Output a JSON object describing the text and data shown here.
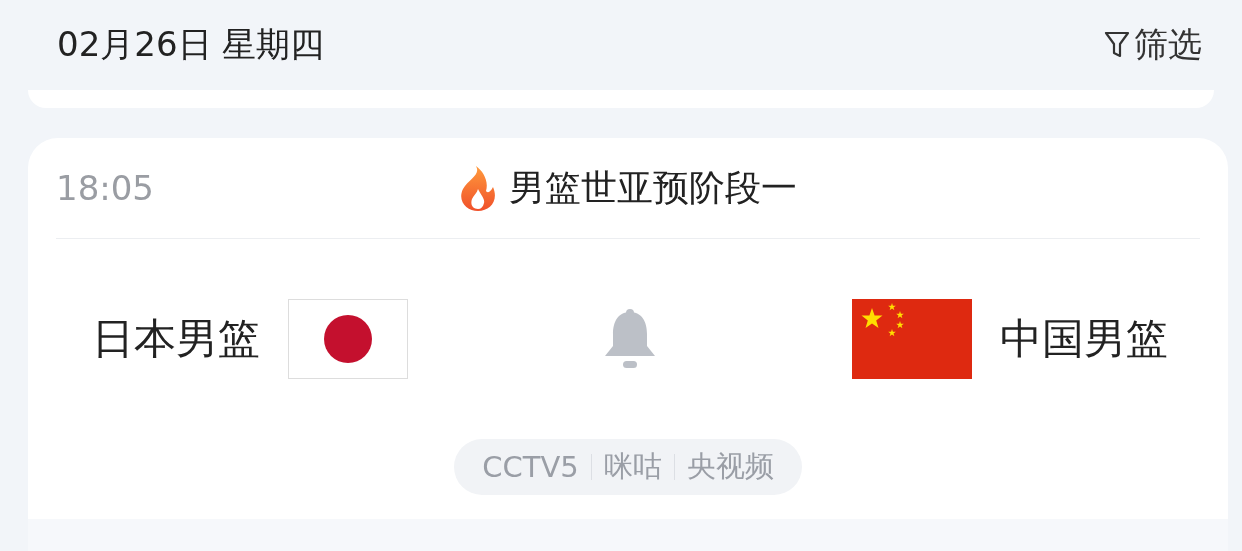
{
  "header": {
    "date": "02月26日 星期四",
    "filter_label": "筛选"
  },
  "match": {
    "time": "18:05",
    "hot": true,
    "title": "男篮世亚预阶段一",
    "reminder_on": false,
    "home": {
      "name": "日本男篮",
      "flag": {
        "kind": "japan"
      }
    },
    "away": {
      "name": "中国男篮",
      "flag": {
        "kind": "china"
      }
    },
    "channels": [
      "CCTV5",
      "咪咕",
      "央视频"
    ]
  }
}
